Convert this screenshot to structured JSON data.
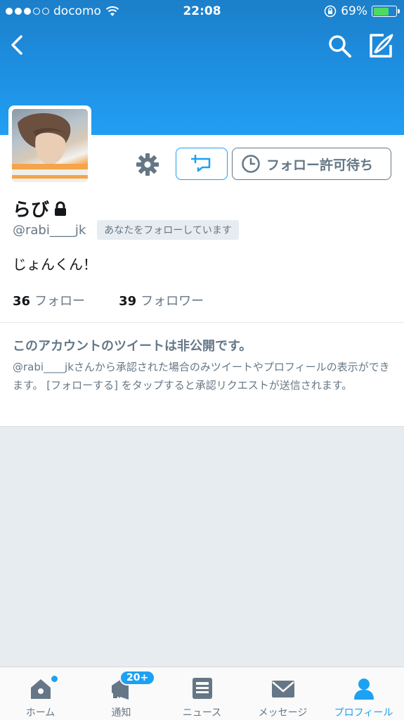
{
  "status_bar": {
    "carrier": "docomo",
    "time": "22:08",
    "battery": "69%",
    "battery_level": 0.69
  },
  "profile": {
    "display_name": "らび",
    "handle": "@rabi____jk",
    "follows_you_badge": "あなたをフォローしています",
    "bio": "じょんくん！",
    "following_count": "36",
    "following_label": "フォロー",
    "followers_count": "39",
    "followers_label": "フォロワー",
    "pending_button_label": "フォロー許可待ち"
  },
  "protected_notice": {
    "title": "このアカウントのツイートは非公開です。",
    "body": "@rabi____jkさんから承認された場合のみツイートやプロフィールの表示ができます。 [フォローする] をタップすると承認リクエストが送信されます。"
  },
  "tabbar": {
    "items": [
      {
        "label": "ホーム",
        "icon": "home-icon"
      },
      {
        "label": "通知",
        "icon": "bell-icon",
        "badge": "20+"
      },
      {
        "label": "ニュース",
        "icon": "news-icon"
      },
      {
        "label": "メッセージ",
        "icon": "mail-icon"
      },
      {
        "label": "プロフィール",
        "icon": "person-icon"
      }
    ],
    "active_index": 4
  },
  "colors": {
    "accent": "#1da1f2",
    "header_top": "#1c7fc9",
    "secondary_text": "#657786"
  }
}
